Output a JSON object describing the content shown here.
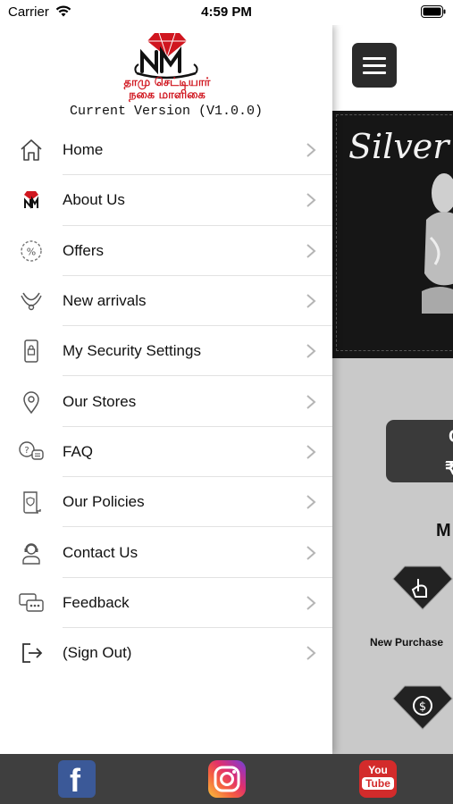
{
  "status_bar": {
    "carrier": "Carrier",
    "time": "4:59 PM"
  },
  "drawer": {
    "logo_alt": "NM தாமு செட்டியார் நகை மாளிகை",
    "logo_line1": "தாமு செட்டியார்",
    "logo_line2": "நகை மாளிகை",
    "version": "Current Version (V1.0.0)",
    "items": [
      {
        "label": "Home",
        "icon": "home-icon"
      },
      {
        "label": "About Us",
        "icon": "logo-icon"
      },
      {
        "label": "Offers",
        "icon": "percent-icon"
      },
      {
        "label": "New arrivals",
        "icon": "necklace-icon"
      },
      {
        "label": "My Security Settings",
        "icon": "phone-lock-icon"
      },
      {
        "label": "Our Stores",
        "icon": "location-pin-icon"
      },
      {
        "label": "FAQ",
        "icon": "chat-question-icon"
      },
      {
        "label": "Our Policies",
        "icon": "policy-scroll-icon"
      },
      {
        "label": "Contact Us",
        "icon": "support-agent-icon"
      },
      {
        "label": "Feedback",
        "icon": "feedback-icon"
      },
      {
        "label": "(Sign Out)",
        "icon": "sign-out-icon"
      }
    ]
  },
  "main": {
    "banner_title": "Silver",
    "card_letter_top": "C",
    "card_letter_bottom": "₹",
    "section_letter": "M",
    "new_purchase": "New Purchase"
  },
  "social": {
    "facebook": "f",
    "youtube_top": "You",
    "youtube_bottom": "Tube"
  },
  "colors": {
    "brand_red": "#d0161f",
    "drawer_bg": "#ffffff",
    "main_bg": "#c9c9c9",
    "social_bar": "#3f3f3f"
  }
}
